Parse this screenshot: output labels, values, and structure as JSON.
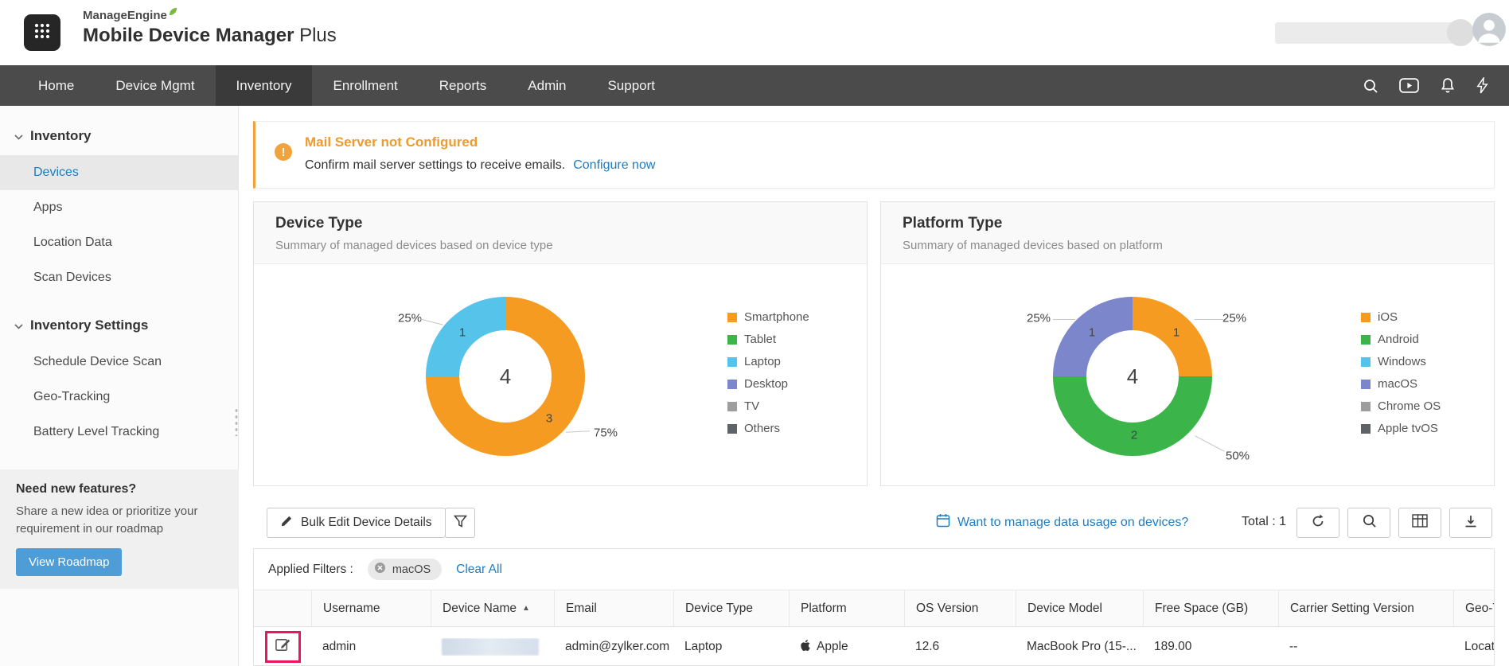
{
  "header": {
    "brand": "ManageEngine",
    "product": "Mobile Device Manager",
    "product_suffix": "Plus"
  },
  "nav": {
    "items": [
      {
        "label": "Home"
      },
      {
        "label": "Device Mgmt"
      },
      {
        "label": "Inventory",
        "active": true
      },
      {
        "label": "Enrollment"
      },
      {
        "label": "Reports"
      },
      {
        "label": "Admin"
      },
      {
        "label": "Support"
      }
    ]
  },
  "sidebar": {
    "sections": [
      {
        "title": "Inventory",
        "items": [
          {
            "label": "Devices",
            "selected": true
          },
          {
            "label": "Apps"
          },
          {
            "label": "Location Data"
          },
          {
            "label": "Scan Devices"
          }
        ]
      },
      {
        "title": "Inventory Settings",
        "items": [
          {
            "label": "Schedule Device Scan"
          },
          {
            "label": "Geo-Tracking"
          },
          {
            "label": "Battery Level Tracking"
          }
        ]
      }
    ],
    "promo": {
      "title": "Need new features?",
      "body": "Share a new idea or prioritize your requirement in our roadmap",
      "button": "View Roadmap"
    }
  },
  "alert": {
    "title": "Mail Server not Configured",
    "body": "Confirm mail server settings to receive emails.",
    "link": "Configure now"
  },
  "toolbar": {
    "bulk_edit": "Bulk Edit Device Details",
    "usage_link": "Want to manage data usage on devices?",
    "total": "Total : 1"
  },
  "filters": {
    "label": "Applied Filters :",
    "chips": [
      {
        "label": "macOS"
      }
    ],
    "clear": "Clear All"
  },
  "table": {
    "columns": [
      "Username",
      "Device Name",
      "Email",
      "Device Type",
      "Platform",
      "OS Version",
      "Device Model",
      "Free Space (GB)",
      "Carrier Setting Version",
      "Geo-T"
    ],
    "rows": [
      {
        "username": "admin",
        "device_name_redacted": true,
        "email": "admin@zylker.com",
        "device_type": "Laptop",
        "platform": "Apple",
        "os_version": "12.6",
        "device_model": "MacBook Pro (15-...",
        "free_space_gb": "189.00",
        "carrier_setting_version": "--",
        "geo": "Locati"
      }
    ]
  },
  "chart_data": [
    {
      "type": "pie",
      "title": "Device Type",
      "subtitle": "Summary of managed devices based on device type",
      "total": 4,
      "segments": [
        {
          "label": "Smartphone",
          "value": 3,
          "pct": "75%",
          "color": "#F59B22"
        },
        {
          "label": "Laptop",
          "value": 1,
          "pct": "25%",
          "color": "#55C3EA"
        }
      ],
      "legend": [
        {
          "label": "Smartphone",
          "color": "#F59B22"
        },
        {
          "label": "Tablet",
          "color": "#3BB54A"
        },
        {
          "label": "Laptop",
          "color": "#55C3EA"
        },
        {
          "label": "Desktop",
          "color": "#7B86CB"
        },
        {
          "label": "TV",
          "color": "#9E9E9E"
        },
        {
          "label": "Others",
          "color": "#5E6367"
        }
      ]
    },
    {
      "type": "pie",
      "title": "Platform Type",
      "subtitle": "Summary of managed devices based on platform",
      "total": 4,
      "segments": [
        {
          "label": "iOS",
          "value": 1,
          "pct": "25%",
          "color": "#F59B22"
        },
        {
          "label": "Android",
          "value": 2,
          "pct": "50%",
          "color": "#3BB54A"
        },
        {
          "label": "macOS",
          "value": 1,
          "pct": "25%",
          "color": "#7B86CB"
        }
      ],
      "legend": [
        {
          "label": "iOS",
          "color": "#F59B22"
        },
        {
          "label": "Android",
          "color": "#3BB54A"
        },
        {
          "label": "Windows",
          "color": "#55C3EA"
        },
        {
          "label": "macOS",
          "color": "#7B86CB"
        },
        {
          "label": "Chrome OS",
          "color": "#9E9E9E"
        },
        {
          "label": "Apple tvOS",
          "color": "#5E6367"
        }
      ]
    }
  ],
  "colors": {
    "accent_blue": "#1D7DC2",
    "alert_orange": "#EF9A2C",
    "highlight_red": "#ED155F",
    "roadmap_button_blue": "#4F9DD7"
  }
}
